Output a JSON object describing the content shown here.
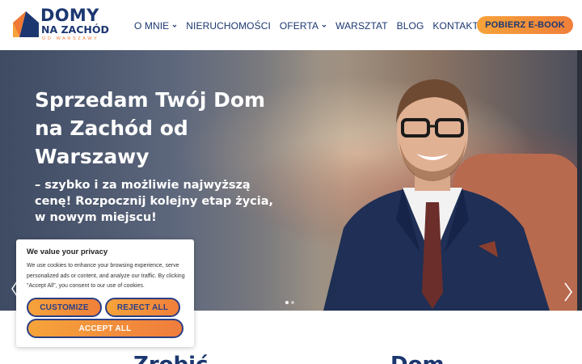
{
  "logo": {
    "line1": "DOMY",
    "line2": "NA ZACHÓD",
    "line3": "OD WARSZAWY"
  },
  "nav": {
    "items": [
      {
        "label": "O MNIE",
        "dropdown": true
      },
      {
        "label": "NIERUCHOMOŚCI",
        "dropdown": false
      },
      {
        "label": "OFERTA",
        "dropdown": true
      },
      {
        "label": "WARSZTAT",
        "dropdown": false
      },
      {
        "label": "BLOG",
        "dropdown": false
      },
      {
        "label": "KONTAKT",
        "dropdown": false
      }
    ],
    "cta_label": "POBIERZ E-BOOK"
  },
  "hero": {
    "title": "Sprzedam Twój Dom na Zachód od Warszawy",
    "subtitle": "– szybko i za możliwie najwyższą cenę! Rozpocznij kolejny etap życia, w nowym miejscu!",
    "slides": 2,
    "active_slide": 1
  },
  "section": {
    "heading_partial_1": "Zrobić",
    "heading_partial_2": "Dom"
  },
  "cookie": {
    "title": "We value your privacy",
    "text": "We use cookies to enhance your browsing experience, serve personalized ads or content, and analyze our traffic. By clicking \"Accept All\", you consent to our use of cookies.",
    "customize_label": "CUSTOMIZE",
    "reject_label": "REJECT ALL",
    "accept_label": "ACCEPT ALL"
  },
  "colors": {
    "brand_navy": "#1c3770",
    "brand_orange": "#f07f3a",
    "cookie_button_border": "#2b3f86"
  }
}
